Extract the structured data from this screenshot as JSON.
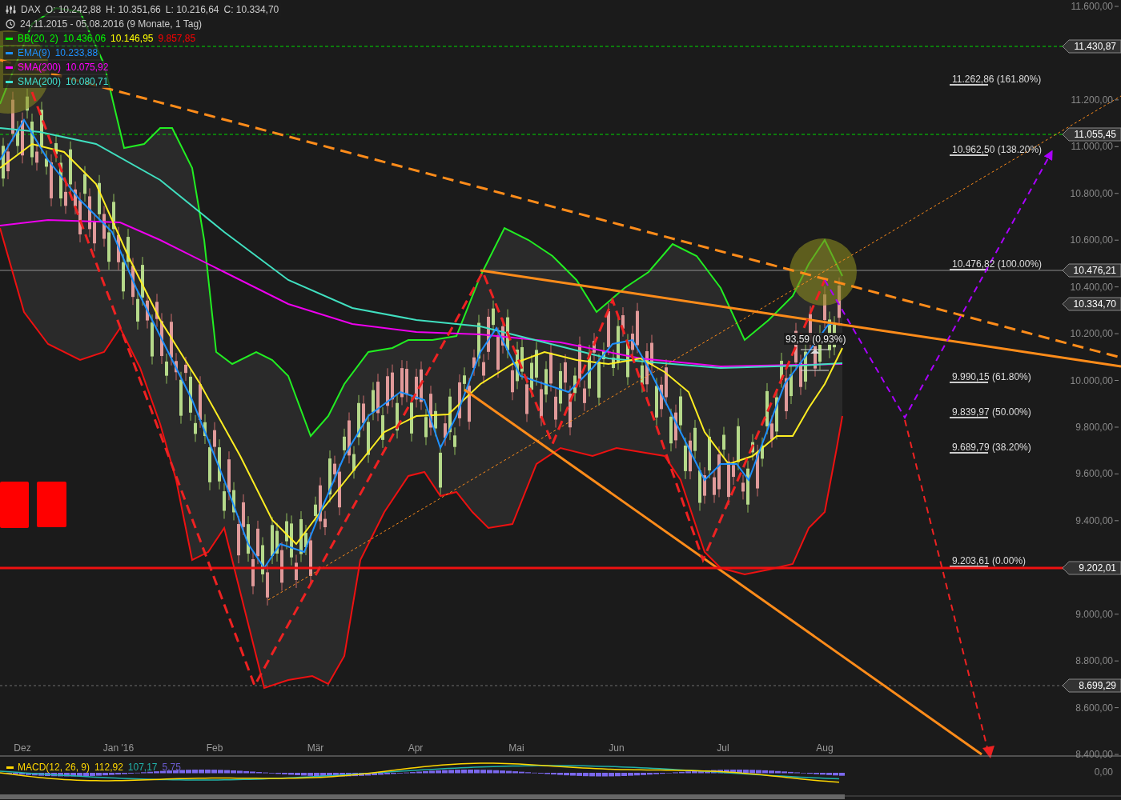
{
  "legend": {
    "symbol": "DAX",
    "ohlc": [
      {
        "label": "O:",
        "value": "10.242,88"
      },
      {
        "label": "H:",
        "value": "10.351,66"
      },
      {
        "label": "L:",
        "value": "10.216,64"
      },
      {
        "label": "C:",
        "value": "10.334,70"
      }
    ],
    "range": "24.11.2015 - 05.08.2016 (9 Monate, 1 Tag)",
    "indicators": [
      {
        "name": "BB(20, 2)",
        "color": "#00ff00",
        "values": [
          {
            "text": "10.436,06",
            "color": "#00ff00"
          },
          {
            "text": "10.146,95",
            "color": "#ffff00"
          },
          {
            "text": "9.857,85",
            "color": "#ff0000"
          }
        ]
      },
      {
        "name": "EMA(9)",
        "color": "#1e90ff",
        "values": [
          {
            "text": "10.233,88",
            "color": "#1e90ff"
          }
        ]
      },
      {
        "name": "SMA(200)",
        "color": "#ff00ff",
        "values": [
          {
            "text": "10.075,92",
            "color": "#ff00ff"
          }
        ]
      },
      {
        "name": "SMA(200)",
        "color": "#40e0d0",
        "values": [
          {
            "text": "10.080,71",
            "color": "#40e0d0"
          }
        ]
      }
    ]
  },
  "y_axis": [
    "11.600,00",
    "11.200,00",
    "11.000,00",
    "10.800,00",
    "10.600,00",
    "10.400,00",
    "10.200,00",
    "10.000,00",
    "9.800,00",
    "9.600,00",
    "9.400,00",
    "9.000,00",
    "8.800,00",
    "8.600,00",
    "8.400,00"
  ],
  "x_axis": [
    "Dez",
    "Jan '16",
    "Feb",
    "Mär",
    "Apr",
    "Mai",
    "Jun",
    "Jul",
    "Aug"
  ],
  "price_tags": [
    "11.430,87",
    "11.055,45",
    "10.476,21",
    "10.334,70",
    "9.202,01",
    "8.699,29"
  ],
  "fib_levels": [
    {
      "value": "11.262,86",
      "percent": "(161.80%)"
    },
    {
      "value": "10.962,50",
      "percent": "(138.20%)"
    },
    {
      "value": "10.476,82",
      "percent": "(100.00%)"
    },
    {
      "value": "9.990,15",
      "percent": "(61.80%)"
    },
    {
      "value": "9.839,97",
      "percent": "(50.00%)"
    },
    {
      "value": "9.689,79",
      "percent": "(38.20%)"
    },
    {
      "value": "9.203,61",
      "percent": "(0.00%)"
    }
  ],
  "measure": "93,59 (0,93%)",
  "macd": {
    "name": "MACD(12, 26, 9)",
    "color": "#ffd700",
    "values": [
      {
        "text": "112,92",
        "color": "#ffd700"
      },
      {
        "text": "107,17",
        "color": "#20b2aa"
      },
      {
        "text": "5,75",
        "color": "#6a5acd"
      }
    ],
    "axis": "0,00"
  }
}
